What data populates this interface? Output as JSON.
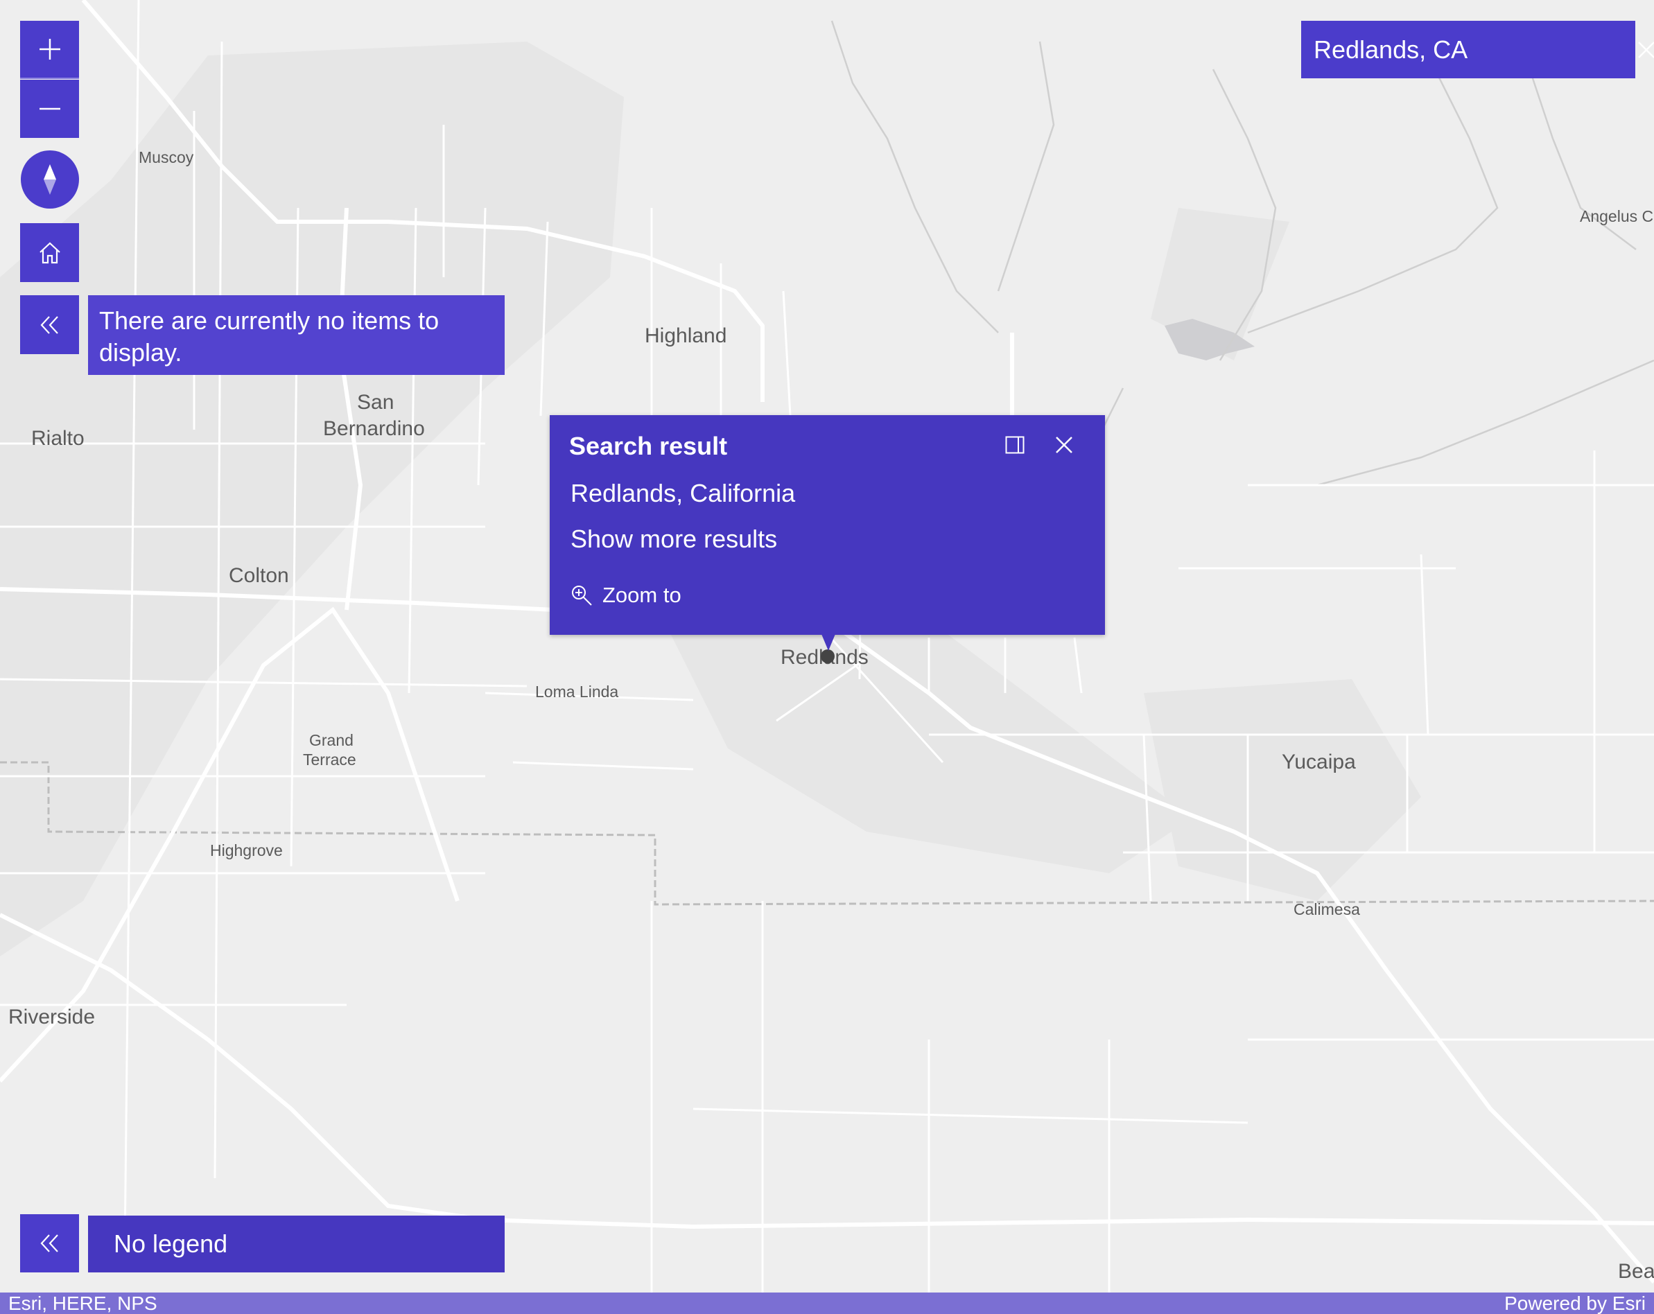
{
  "colors": {
    "ui_background": "#4b3ccb",
    "popup_background": "#4637bf",
    "attribution_background": "#7b6fd3",
    "map_background": "#eeeeee",
    "road": "#ffffff",
    "label": "#5a5a5a"
  },
  "controls": {
    "zoom_in_icon": "plus-icon",
    "zoom_out_icon": "minus-icon",
    "compass_icon": "compass-icon",
    "home_icon": "home-icon",
    "collapse_icon": "chevrons-left-icon"
  },
  "layer_list": {
    "message": "There are currently no items to display."
  },
  "search": {
    "value": "Redlands, CA",
    "clear_icon": "close-icon",
    "submit_icon": "search-icon"
  },
  "popup": {
    "title": "Search result",
    "location": "Redlands, California",
    "more_results": "Show more results",
    "zoom_to": "Zoom to",
    "dock_icon": "dock-icon",
    "close_icon": "close-icon",
    "zoom_icon": "zoom-in-icon"
  },
  "legend": {
    "message": "No legend"
  },
  "map": {
    "labels": {
      "muscoy": "Muscoy",
      "highland": "Highland",
      "san": "San",
      "bernardino": "Bernardino",
      "rialto": "Rialto",
      "colton": "Colton",
      "redlands": "Redlands",
      "loma_linda": "Loma Linda",
      "grand": "Grand",
      "terrace": "Terrace",
      "highgrove": "Highgrove",
      "yucaipa": "Yucaipa",
      "calimesa": "Calimesa",
      "riverside": "Riverside",
      "angelus": "Angelus C",
      "bea": "Bea"
    }
  },
  "attribution": {
    "sources": "Esri, HERE, NPS",
    "powered_by": "Powered by Esri"
  }
}
